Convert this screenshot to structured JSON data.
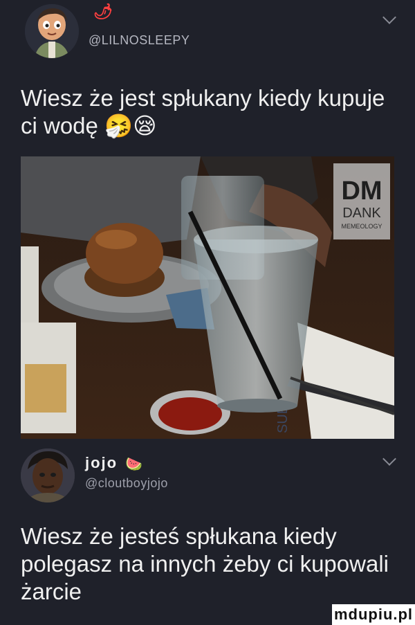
{
  "tweet1": {
    "handle": "@LILNOSLEEPY",
    "badge": "🌶",
    "text": "Wiesz że jest spłukany kiedy kupuje ci wodę 🤧😪"
  },
  "media": {
    "logo_top": "DM",
    "logo_mid": "DANK",
    "logo_bottom": "MEMEOLOGY",
    "cup_text": "SUB"
  },
  "tweet2": {
    "display_name": "jojo",
    "badge": "🍉",
    "handle": "@cloutboyjojo",
    "text": "Wiesz że jesteś spłukana kiedy polegasz na innych żeby ci kupowali żarcie"
  },
  "watermark": "mdupiu.pl",
  "colors": {
    "background": "#1f212a",
    "text": "#f0f0f0",
    "handle": "#b6b8c2"
  }
}
